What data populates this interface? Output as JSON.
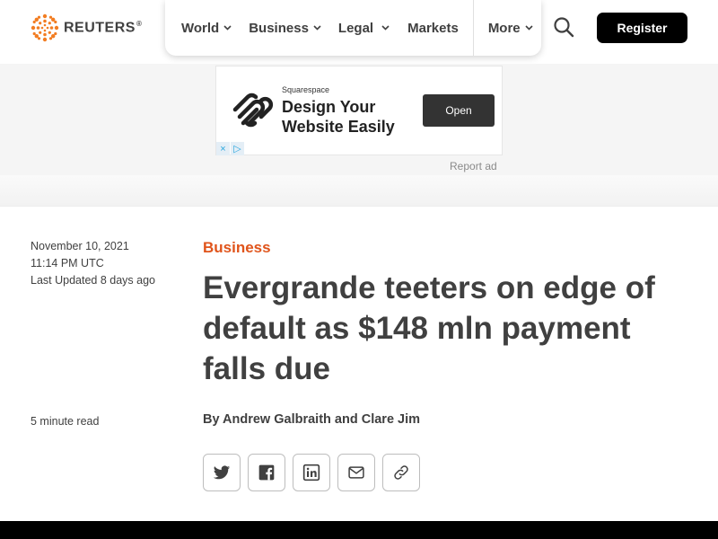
{
  "header": {
    "logo_text": "REUTERS",
    "logo_reg": "®",
    "nav": [
      {
        "label": "World",
        "has_menu": true
      },
      {
        "label": "Business",
        "has_menu": true
      },
      {
        "label": "Legal",
        "has_menu": true
      },
      {
        "label": "Markets",
        "has_menu": false
      },
      {
        "label": "More",
        "has_menu": true
      }
    ],
    "register_label": "Register",
    "accent_color": "#e0541b"
  },
  "ad": {
    "sponsor": "Squarespace",
    "headline": "Design Your Website Easily",
    "cta": "Open",
    "report_label": "Report ad",
    "choices": [
      "×",
      "▷"
    ]
  },
  "article": {
    "date": "November 10, 2021",
    "time": "11:14 PM UTC",
    "updated": "Last Updated 8 days ago",
    "read_time": "5 minute read",
    "section": "Business",
    "headline": "Evergrande teeters on edge of default as $148 mln payment falls due",
    "byline_prefix": "By ",
    "author_1": "Andrew Galbraith",
    "byline_and": " and ",
    "author_2": "Clare Jim"
  },
  "share": [
    "twitter-icon",
    "facebook-icon",
    "linkedin-icon",
    "email-icon",
    "link-icon"
  ]
}
